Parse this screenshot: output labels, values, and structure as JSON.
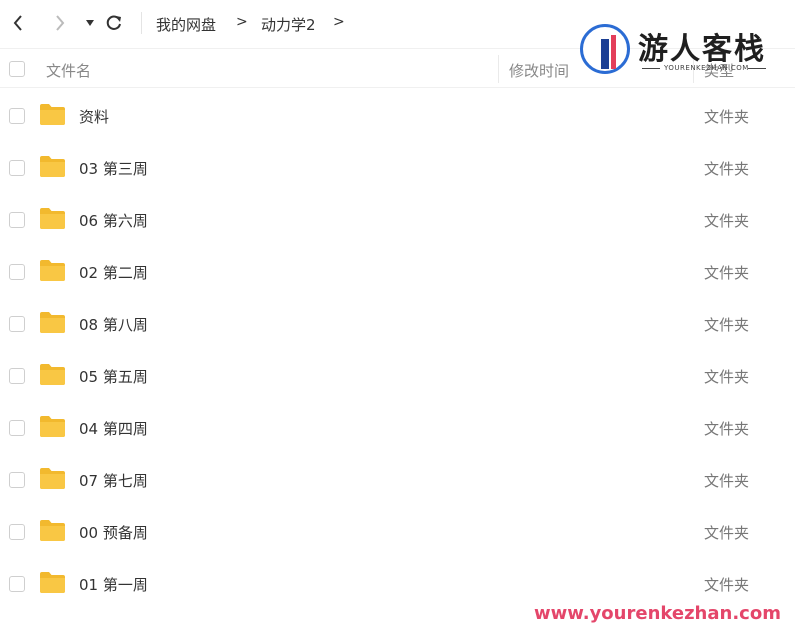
{
  "toolbar": {
    "back_icon": "chevron-left-icon",
    "forward_icon": "chevron-right-icon",
    "dropdown_icon": "caret-down-icon",
    "refresh_icon": "refresh-icon"
  },
  "breadcrumb": {
    "items": [
      "我的网盘",
      "动力学2"
    ],
    "separator": ">"
  },
  "columns": {
    "name": "文件名",
    "modified": "修改时间",
    "type": "类型"
  },
  "files": [
    {
      "name": "资料",
      "type": "文件夹"
    },
    {
      "name": "03 第三周",
      "type": "文件夹"
    },
    {
      "name": "06 第六周",
      "type": "文件夹"
    },
    {
      "name": "02 第二周",
      "type": "文件夹"
    },
    {
      "name": "08 第八周",
      "type": "文件夹"
    },
    {
      "name": "05 第五周",
      "type": "文件夹"
    },
    {
      "name": "04 第四周",
      "type": "文件夹"
    },
    {
      "name": "07 第七周",
      "type": "文件夹"
    },
    {
      "name": "00 预备周",
      "type": "文件夹"
    },
    {
      "name": "01 第一周",
      "type": "文件夹"
    }
  ],
  "watermark": {
    "title": "游人客栈",
    "subtitle": "YOURENKEZHAN.COM",
    "url": "www.yourenkezhan.com"
  },
  "colors": {
    "folder": "#f9c744",
    "folder_dark": "#f2b92e",
    "watermark_url": "#e4466a",
    "logo_blue": "#2b6cd4"
  }
}
